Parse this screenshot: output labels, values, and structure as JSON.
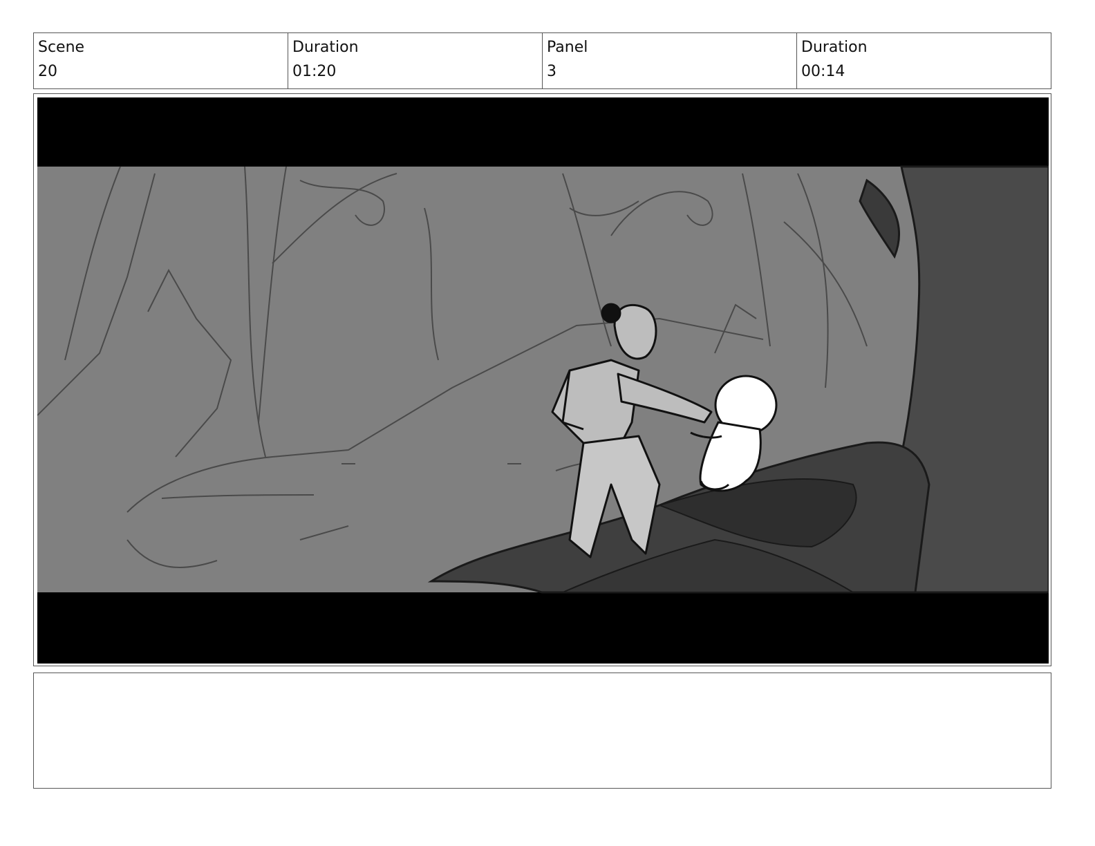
{
  "header": {
    "scene_label": "Scene",
    "scene_value": "20",
    "scene_duration_label": "Duration",
    "scene_duration_value": "01:20",
    "panel_label": "Panel",
    "panel_value": "3",
    "panel_duration_label": "Duration",
    "panel_duration_value": "00:14"
  },
  "frame": {
    "letterbox_color": "#000000",
    "background_color": "#808080",
    "foreground_color": "#3f3f3f",
    "figure_color": "#bdbdbd"
  },
  "notes": {
    "text": ""
  }
}
